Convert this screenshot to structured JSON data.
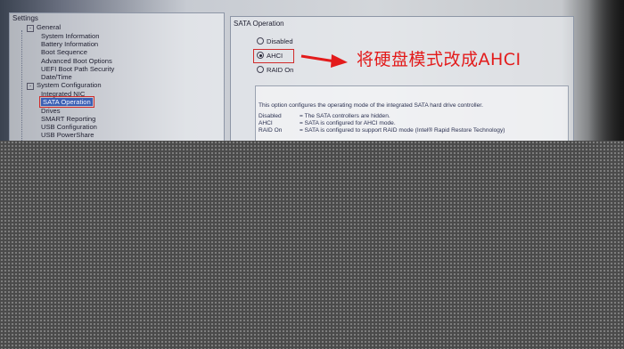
{
  "left_panel": {
    "title": "Settings",
    "items": [
      {
        "label": "General",
        "level": 1,
        "expanded": true
      },
      {
        "label": "System Information",
        "level": 2
      },
      {
        "label": "Battery Information",
        "level": 2
      },
      {
        "label": "Boot Sequence",
        "level": 2
      },
      {
        "label": "Advanced Boot Options",
        "level": 2
      },
      {
        "label": "UEFI Boot Path Security",
        "level": 2
      },
      {
        "label": "Date/Time",
        "level": 2
      },
      {
        "label": "System Configuration",
        "level": 1,
        "expanded": true
      },
      {
        "label": "Integrated NIC",
        "level": 2
      },
      {
        "label": "SATA Operation",
        "level": 2,
        "selected": true
      },
      {
        "label": "Drives",
        "level": 2
      },
      {
        "label": "SMART Reporting",
        "level": 2
      },
      {
        "label": "USB Configuration",
        "level": 2
      },
      {
        "label": "USB PowerShare",
        "level": 2
      }
    ]
  },
  "right_panel": {
    "title": "SATA Operation",
    "options": [
      {
        "label": "Disabled",
        "selected": false
      },
      {
        "label": "AHCI",
        "selected": true
      },
      {
        "label": "RAID On",
        "selected": false
      }
    ],
    "description": "This option configures the operating mode of the integrated SATA hard drive controller.",
    "definitions": [
      {
        "key": "Disabled",
        "value": "= The SATA controllers are hidden."
      },
      {
        "key": "AHCI",
        "value": "= SATA is configured for AHCI mode."
      },
      {
        "key": "RAID On",
        "value": "= SATA is configured to support RAID mode (Intel® Rapid Restore Technology)"
      }
    ]
  },
  "annotation": {
    "text": "将硬盘模式改成AHCI",
    "color": "#e31b1b"
  }
}
